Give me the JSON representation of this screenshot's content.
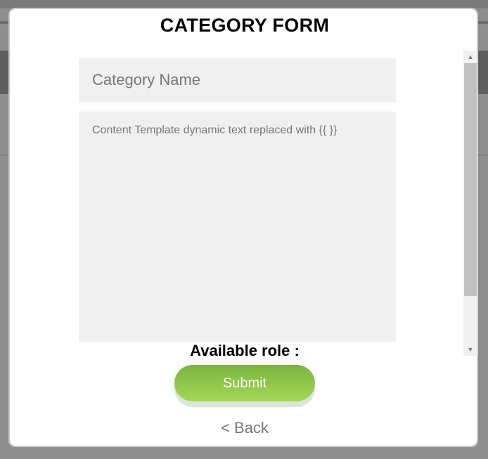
{
  "form": {
    "title": "CATEGORY FORM",
    "name_placeholder": "Category Name",
    "content_placeholder": "Content Template dynamic text replaced with {{ }}",
    "role_label": "Available role :",
    "submit_label": "Submit",
    "back_label": "< Back"
  },
  "scrollbar": {
    "up_arrow": "▲",
    "down_arrow": "▼"
  },
  "colors": {
    "button_top": "#79b43e",
    "button_bottom": "#a6d858",
    "field_bg": "#f0f0f0"
  }
}
